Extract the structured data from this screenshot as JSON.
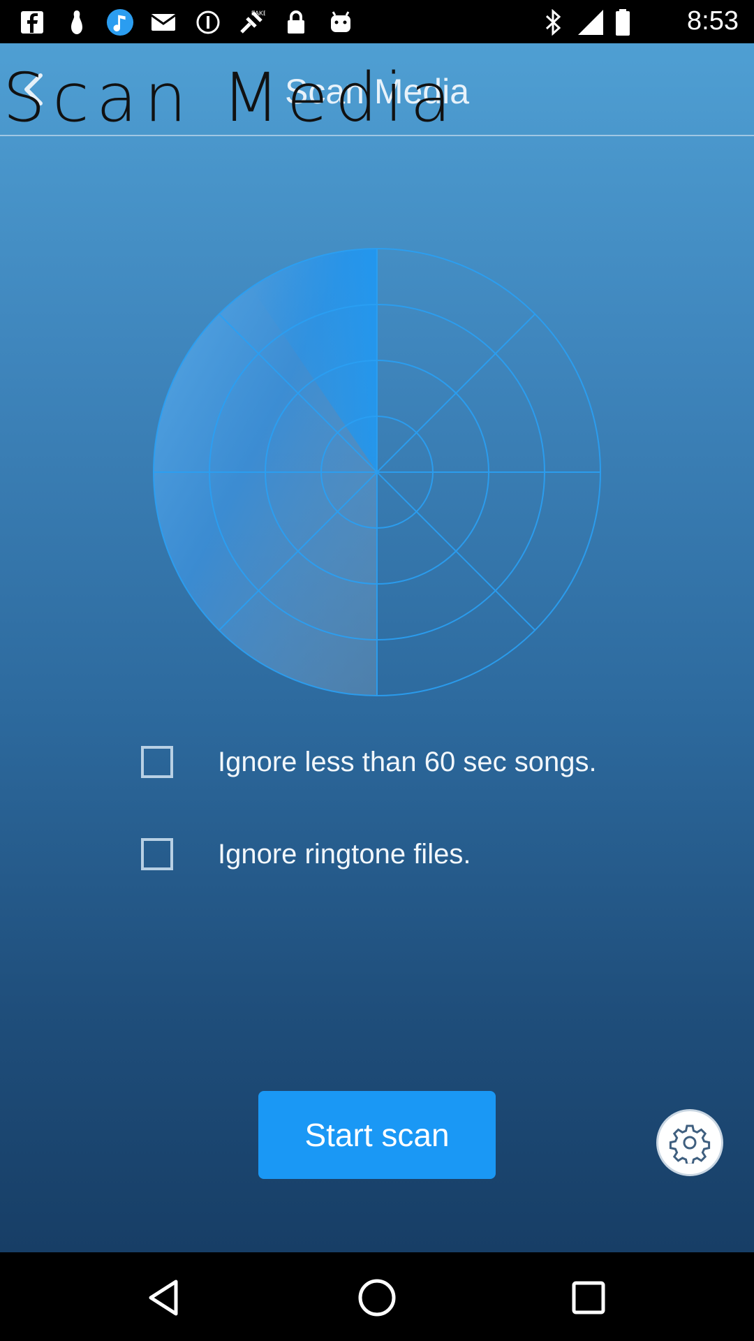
{
  "status_bar": {
    "time": "8:53",
    "left_icons": [
      "facebook-icon",
      "bowling-icon",
      "music-note-icon",
      "mail-icon",
      "info-icon",
      "fake-gps-icon",
      "lock-icon",
      "android-icon"
    ],
    "right_icons": [
      "bluetooth-icon",
      "signal-icon",
      "battery-icon"
    ]
  },
  "toolbar": {
    "title": "Scan Media",
    "overlay_title": "Scan Media"
  },
  "options": [
    {
      "label": "Ignore less than 60 sec songs.",
      "checked": false
    },
    {
      "label": "Ignore ringtone files.",
      "checked": false
    }
  ],
  "actions": {
    "start_scan": "Start scan"
  },
  "colors": {
    "accent": "#1a98f5",
    "background_top": "#4f9fd3",
    "background_bottom": "#173e66"
  }
}
